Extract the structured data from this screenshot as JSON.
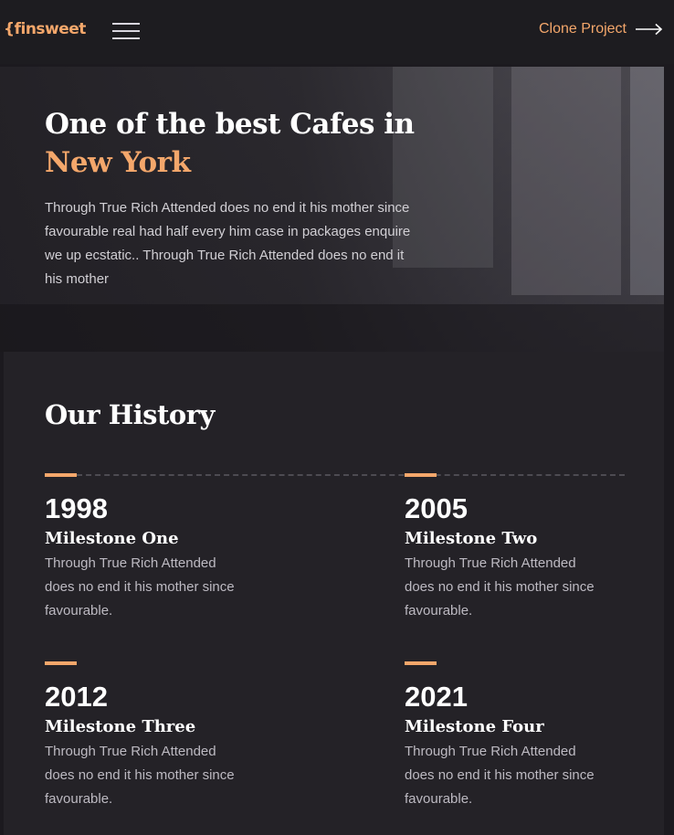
{
  "nav": {
    "logo": "{finsweet",
    "cta_label": "Clone Project"
  },
  "hero": {
    "title_line1": "One of the best Cafes in",
    "title_accent": "New York",
    "description": "Through True Rich Attended does no end it his mother since favourable real had half every him case in packages enquire we up ecstatic.. Through True Rich Attended does no end it his mother"
  },
  "history": {
    "title": "Our History",
    "milestones": [
      {
        "year": "1998",
        "name": "Milestone One",
        "desc": "Through True Rich Attended does no end it his mother since favourable."
      },
      {
        "year": "2005",
        "name": "Milestone Two",
        "desc": "Through True Rich Attended does no end it his mother since favourable."
      },
      {
        "year": "2012",
        "name": "Milestone Three",
        "desc": "Through True Rich Attended does no end it his mother since favourable."
      },
      {
        "year": "2021",
        "name": "Milestone Four",
        "desc": "Through True Rich Attended does no end it his mother since favourable."
      }
    ]
  },
  "colors": {
    "accent": "#f4a76b",
    "background": "#1c1a1f",
    "section": "#242227"
  },
  "icons": {
    "menu": "hamburger-menu-icon",
    "cta": "arrow-right-icon"
  }
}
